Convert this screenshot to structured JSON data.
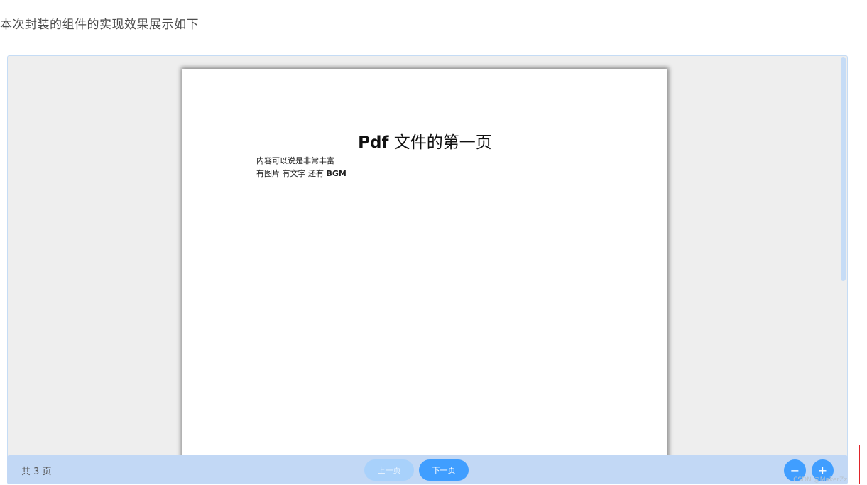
{
  "intro_text": "本次封装的组件的实现效果展示如下",
  "pdf_page": {
    "title_latin": "Pdf",
    "title_cjk": " 文件的第一页",
    "line1": "内容可以说是非常丰富",
    "line2_prefix": "有图片  有文字  还有 ",
    "line2_bold": "BGM"
  },
  "toolbar": {
    "page_count": "共 3 页",
    "prev_label": "上一页",
    "next_label": "下一页",
    "zoom_out_symbol": "−",
    "zoom_in_symbol": "+"
  },
  "watermark": "CSDN @MakerZz",
  "colors": {
    "accent": "#409eff",
    "accent_disabled": "#a8d1fb",
    "toolbar_bg": "#c2d8f5",
    "viewer_bg": "#eeeeee",
    "highlight_border": "#e0242a"
  },
  "icons": {
    "zoom_out": "minus-icon",
    "zoom_in": "plus-icon"
  }
}
